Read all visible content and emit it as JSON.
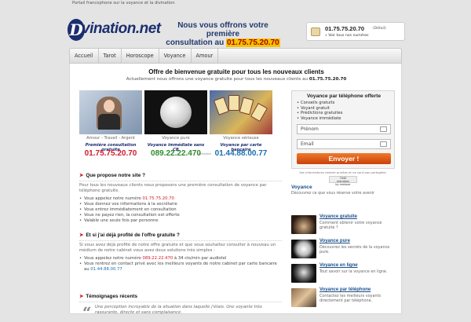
{
  "topbar": {
    "tagline": "Portail francophone sur la voyance et la divination"
  },
  "header": {
    "logo_letter": "D",
    "logo_word": "vination.net",
    "promo_line1": "Nous vous offrons votre première",
    "promo_line2": "consultation au",
    "promo_number": "01.75.75.20.70",
    "phone_number": "01.75.75.20.70",
    "phone_detail": "(Détail)",
    "phone_others": "» Voir tous nos numéros"
  },
  "nav": {
    "items": [
      "Accueil",
      "Tarot",
      "Horoscope",
      "Voyance",
      "Amour"
    ]
  },
  "offer": {
    "title": "Offre de bienvenue gratuite pour tous les nouveaux clients",
    "sub_prefix": "Actuellement nous offrons une voyance gratuite pour tous les nouveaux clients au",
    "sub_number": "01.75.75.20.70"
  },
  "cards": [
    {
      "caption": "Amour - Travail - Argent",
      "subtitle": "Première consultation gratuite",
      "number": "01.75.75.20.70",
      "color": "#d11b2e"
    },
    {
      "caption": "Voyance pure",
      "subtitle": "Voyance immédiate sans CB",
      "number": "089.22.22.470",
      "note": "34cts/min",
      "color": "#2e8b2e"
    },
    {
      "caption": "Voyance sérieuse",
      "subtitle": "Voyance par carte bancaire",
      "number": "01.44.88.00.77",
      "color": "#1b6fb0"
    }
  ],
  "section1": {
    "title": "Que propose notre site ?",
    "intro": "Pour tous les nouveaux clients nous proposons une première consultation de voyance par téléphone gratuite.",
    "items": [
      {
        "before": "Vous appelez notre numéro ",
        "highlight": "01.75.75.20.70"
      },
      {
        "before": "Vous donnez vos informations à la secrétaire",
        "highlight": ""
      },
      {
        "before": "Vous entrez immédiatement en consultation",
        "highlight": ""
      },
      {
        "before": "Vous ne payez rien, la consultation est offerte",
        "highlight": ""
      },
      {
        "before": "Valable une seule fois par personne",
        "highlight": ""
      }
    ]
  },
  "section2": {
    "title": "Et si j'ai déjà profité de l'offre gratuite ?",
    "intro": "Si vous avez déjà profité de notre offre gratuite et que vous souhaitez consulter à nouveau un médium de notre cabinet vous avez deux solutions très simples :",
    "item1_before": "Vous appelez notre numéro ",
    "item1_number": "089.22.22.470",
    "item1_after": " à 34 cts/min par audiotel",
    "item2_before": "Vous rentrez en contact privé avec les meilleurs voyants de notre cabinet par carte bancaire au ",
    "item2_number": "01.44.88.00.77"
  },
  "section3": {
    "title": "Témoignages récents",
    "quote_mark": "“",
    "quote": "Une perception incroyable de la situation dans laquelle j'étais. Une voyante très rassurante, directe et sans complaisance."
  },
  "form": {
    "title": "Voyance par téléphone offerte",
    "benefits": [
      "Conseils gratuits",
      "Voyant gratuit",
      "Prédictions gratuites",
      "Voyance immédiate"
    ],
    "prenom_placeholder": "Prénom",
    "email_placeholder": "Email",
    "submit_label": "Envoyer !",
    "legal": "Vos informations restent privées et ne sont pas partagées.",
    "counter_value": "7040",
    "counter_label1": "membres",
    "counter_label2": "by mmbesr"
  },
  "sidebar": {
    "title": "Voyance",
    "subtitle": "Découvrez ce que vous réserve votre avenir",
    "items": [
      {
        "title": "Voyance gratuite",
        "desc": "Comment obtenir votre voyance gratuite ?"
      },
      {
        "title": "Voyance pure",
        "desc": "Découvrez les secrets de la voyance pure."
      },
      {
        "title": "Voyance en ligne",
        "desc": "Tout savoir sur la voyance en ligne."
      },
      {
        "title": "Voyance par téléphone",
        "desc": "Contactez les meilleurs voyants directement par téléphone."
      }
    ]
  },
  "colors": {
    "red": "#d11b2e",
    "green": "#2e8b2e",
    "blue": "#1b6fb0",
    "navy": "#1b2e6e",
    "orange": "#e0621d"
  }
}
